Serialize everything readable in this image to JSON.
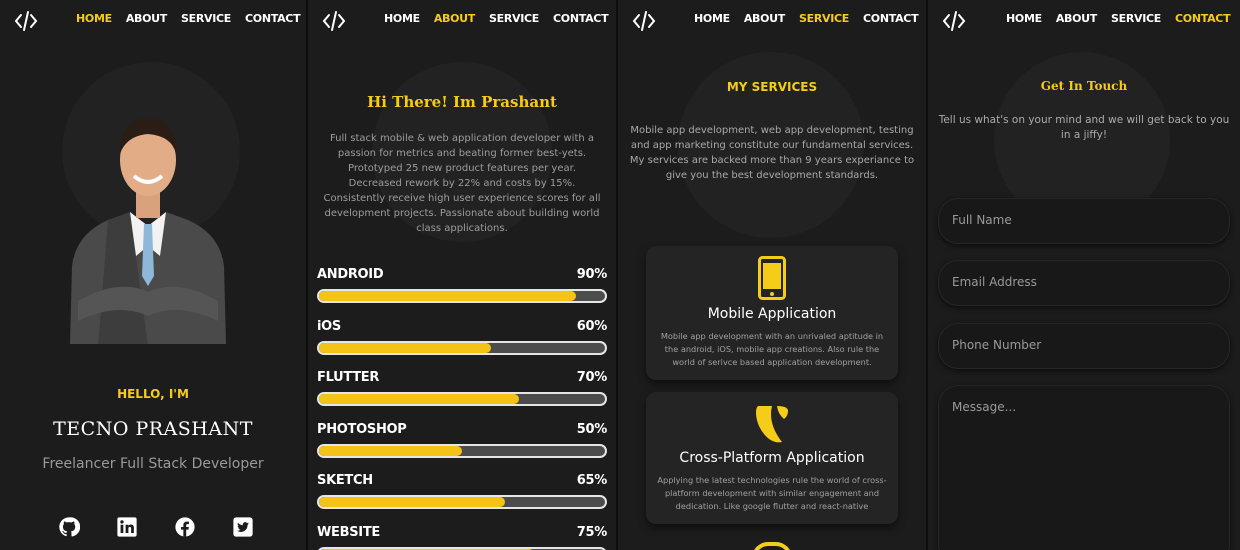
{
  "nav": {
    "items": [
      "HOME",
      "ABOUT",
      "SERVICE",
      "CONTACT"
    ]
  },
  "colors": {
    "accent": "#f5cc17",
    "background": "#1c1c1c",
    "muted": "#9a9a9a"
  },
  "home": {
    "greeting": "HELLO, I'M",
    "name": "TECNO PRASHANT",
    "role": "Freelancer Full Stack Developer",
    "socials": [
      "github-icon",
      "linkedin-icon",
      "facebook-icon",
      "twitter-icon"
    ]
  },
  "about": {
    "title": "Hi There! Im Prashant",
    "text": "Full stack mobile & web application developer with a passion for metrics and beating former best-yets. Prototyped 25 new product features per year. Decreased rework by 22% and costs by 15%. Consistently receive high user experience scores for all development projects. Passionate about building world class applications.",
    "skills": [
      {
        "name": "ANDROID",
        "label": "90%",
        "value": 90
      },
      {
        "name": "iOS",
        "label": "60%",
        "value": 60
      },
      {
        "name": "FLUTTER",
        "label": "70%",
        "value": 70
      },
      {
        "name": "PHOTOSHOP",
        "label": "50%",
        "value": 50
      },
      {
        "name": "SKETCH",
        "label": "65%",
        "value": 65
      },
      {
        "name": "WEBSITE",
        "label": "75%",
        "value": 75
      }
    ]
  },
  "service": {
    "title": "MY SERVICES",
    "text": "Mobile app development, web app development, testing and app marketing constitute our fundamental services. My services are backed more than 9 years experiance to give you the best development standards.",
    "cards": [
      {
        "icon": "mobile-phone-icon",
        "title": "Mobile Application",
        "desc": "Mobile app development with an unrivaled aptitude in the android, iOS, mobile app creations. Also rule the world of serivce based application development."
      },
      {
        "icon": "typo3-icon",
        "title": "Cross-Platform Application",
        "desc": "Applying the latest technologies rule the world of cross-platform development with similar engagement and dedication. Like google flutter and react-native"
      }
    ]
  },
  "contact": {
    "title": "Get In Touch",
    "text": "Tell us what's on your mind and we will get back to you in a jiffy!",
    "fields": {
      "name_placeholder": "Full Name",
      "email_placeholder": "Email Address",
      "phone_placeholder": "Phone Number",
      "message_placeholder": "Message..."
    }
  }
}
